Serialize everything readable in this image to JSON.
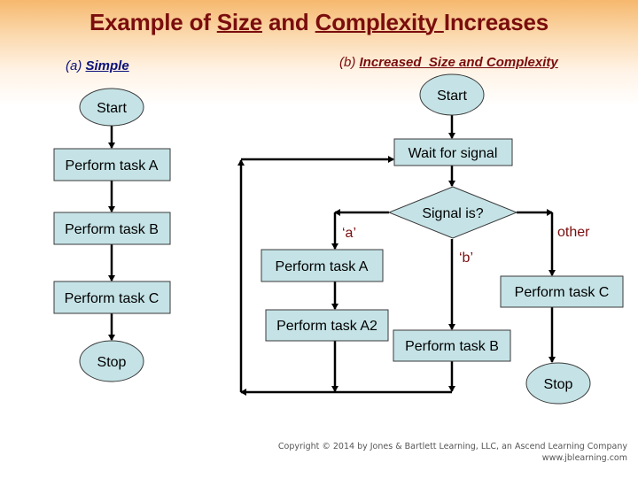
{
  "title": {
    "prefix": "Example of ",
    "word1": "Size",
    "middle": " and ",
    "word2": "Complexity ",
    "suffix": "Increases"
  },
  "panel_a": {
    "label_prefix": "(a) ",
    "label": "Simple",
    "nodes": {
      "start": "Start",
      "task_a": "Perform task A",
      "task_b": "Perform task B",
      "task_c": "Perform task C",
      "stop": "Stop"
    }
  },
  "panel_b": {
    "label_prefix": "(b) ",
    "label": "Increased  Size and Complexity",
    "nodes": {
      "start": "Start",
      "wait": "Wait for signal",
      "decision": "Signal is?",
      "task_a": "Perform task A",
      "task_a2": "Perform task A2",
      "task_b": "Perform task B",
      "task_c": "Perform task C",
      "stop": "Stop"
    },
    "branches": {
      "a": "‘a’",
      "b": "‘b’",
      "other": "other"
    }
  },
  "colors": {
    "node_fill": "#c5e3e6",
    "title": "#7a0d0d",
    "subtitle_a": "#0a0f7a",
    "branch_label": "#7a0d0d"
  },
  "footer": {
    "copyright": "Copyright © 2014 by Jones & Bartlett Learning, LLC, an Ascend Learning Company",
    "url": "www.jblearning.com"
  }
}
